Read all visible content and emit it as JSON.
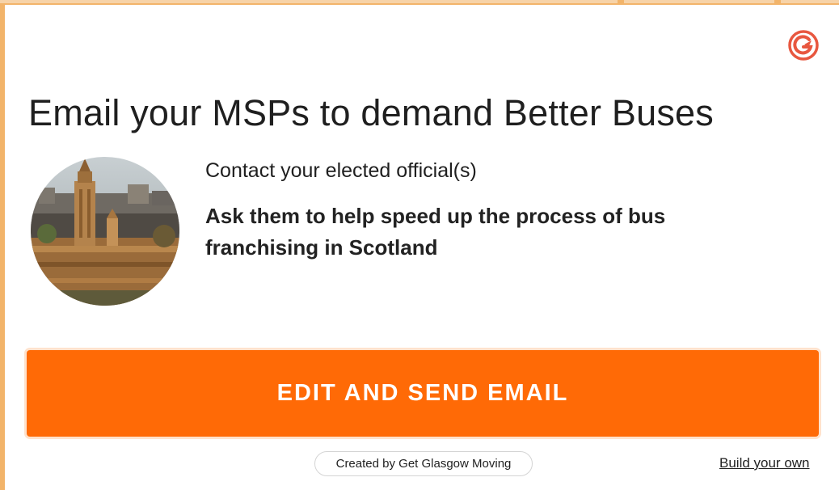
{
  "widget": {
    "title": "Email your MSPs to demand Better Buses",
    "subtitle": "Contact your elected official(s)",
    "ask": "Ask them to help speed up the process of bus franchising in Scotland",
    "send_button_label": "EDIT AND SEND EMAIL",
    "created_by": "Created by Get Glasgow Moving",
    "build_link": "Build your own"
  },
  "icons": {
    "brand": "brand-logo-icon",
    "photo": "parliament-building-photo"
  },
  "colors": {
    "accent": "#ff6a06",
    "page_background": "#f2b46a",
    "card_background": "#ffffff",
    "brand_icon": "#e8573f",
    "text": "#1f1f1f"
  }
}
